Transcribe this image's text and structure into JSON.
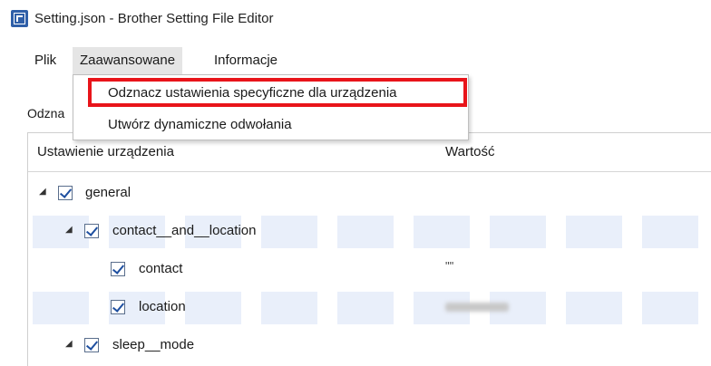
{
  "window": {
    "title": "Setting.json - Brother Setting File Editor"
  },
  "menu": {
    "items": [
      {
        "label": "Plik"
      },
      {
        "label": "Zaawansowane"
      },
      {
        "label": "Informacje"
      }
    ],
    "active": "Zaawansowane",
    "dropdown": [
      {
        "label": "Odznacz ustawienia specyficzne dla urządzenia",
        "highlighted": true
      },
      {
        "label": "Utwórz dynamiczne odwołania"
      }
    ]
  },
  "group_label": "Odzna",
  "grid": {
    "columns": [
      "Ustawienie urządzenia",
      "Wartość"
    ],
    "rows": [
      {
        "label": "general",
        "checked": true,
        "expanded": true,
        "level": 0,
        "value": ""
      },
      {
        "label": "contact__and__location",
        "checked": true,
        "expanded": true,
        "level": 1,
        "value": ""
      },
      {
        "label": "contact",
        "checked": true,
        "level": 2,
        "value": "\"\""
      },
      {
        "label": "location",
        "checked": true,
        "level": 2,
        "value": ""
      },
      {
        "label": "sleep__mode",
        "checked": true,
        "expanded": true,
        "level": 1,
        "value": ""
      }
    ]
  },
  "colors": {
    "highlight": "#e8141a",
    "row_alt": "#e9effa",
    "check": "#1e4fa0"
  }
}
